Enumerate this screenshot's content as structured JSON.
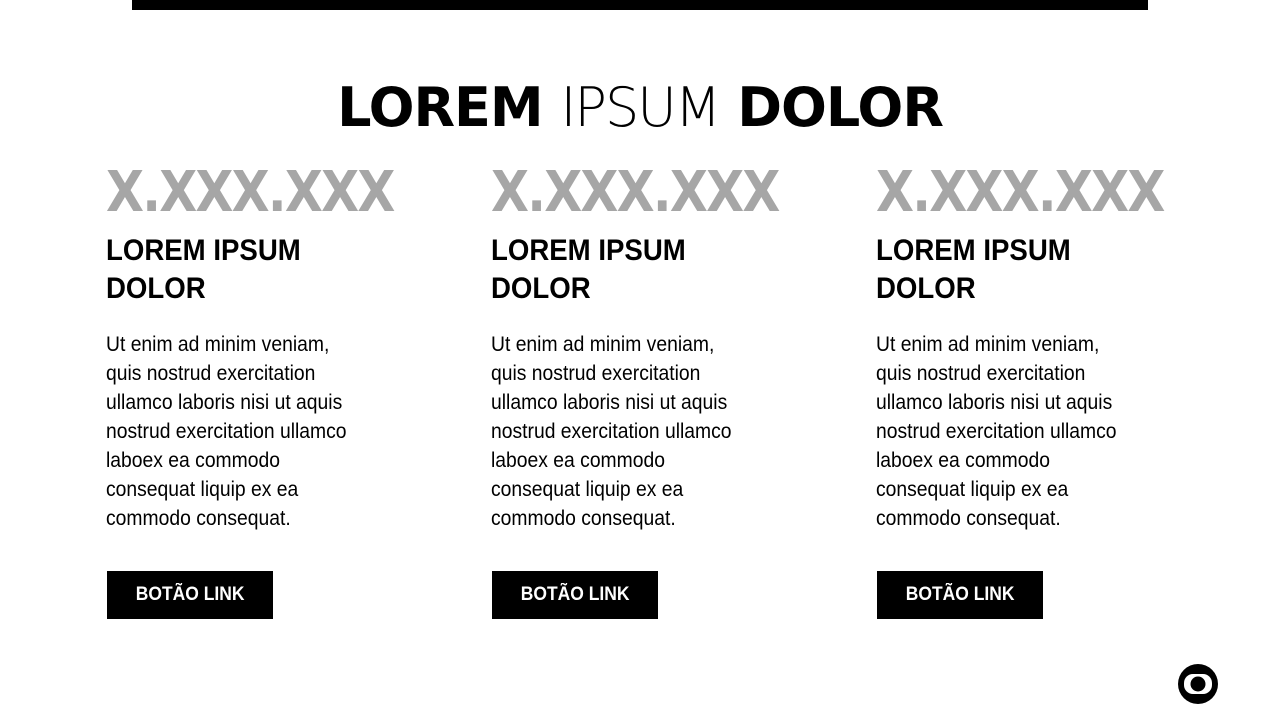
{
  "title": {
    "part1": "LOREM",
    "part2": "IPSUM",
    "part3": "DOLOR"
  },
  "columns": [
    {
      "stat": "X.XXX.XXX",
      "heading": "LOREM IPSUM DOLOR",
      "body": "Ut enim ad minim veniam, quis nostrud exercitation ullamco laboris nisi ut aquis nostrud exercitation ullamco laboex ea commodo consequat liquip ex ea commodo consequat.",
      "button_label": "BOTÃO LINK"
    },
    {
      "stat": "X.XXX.XXX",
      "heading": "LOREM IPSUM DOLOR",
      "body": "Ut enim ad minim veniam, quis nostrud exercitation ullamco laboris nisi ut aquis nostrud exercitation ullamco laboex ea commodo consequat liquip ex ea commodo consequat.",
      "button_label": "BOTÃO LINK"
    },
    {
      "stat": "X.XXX.XXX",
      "heading": "LOREM IPSUM DOLOR",
      "body": "Ut enim ad minim veniam, quis nostrud exercitation ullamco laboris nisi ut aquis nostrud exercitation ullamco laboex ea commodo consequat liquip ex ea commodo consequat.",
      "button_label": "BOTÃO LINK"
    }
  ],
  "logo": {
    "icon": "globo-logo-icon"
  },
  "colors": {
    "background": "#ffffff",
    "text": "#000000",
    "stat": "#a6a6a6",
    "button_bg": "#000000",
    "button_text": "#ffffff"
  }
}
